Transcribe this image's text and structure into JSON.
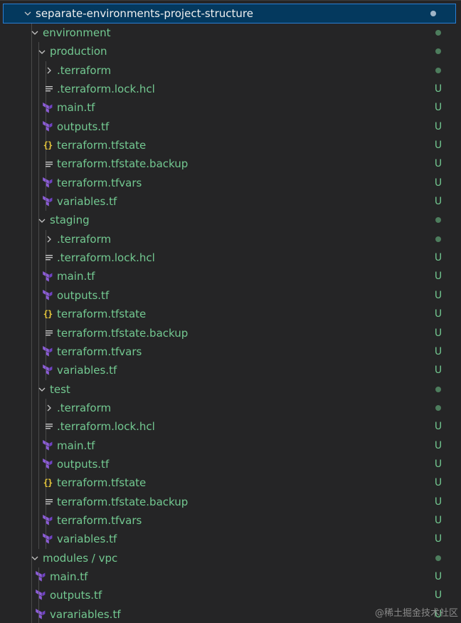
{
  "explorer": {
    "rows": [
      {
        "name": "separate-environments-project-structure",
        "kind": "folder-open",
        "depth": 0,
        "status": "dot",
        "root": true
      },
      {
        "name": "environment",
        "kind": "folder-open",
        "depth": 1,
        "status": "dot"
      },
      {
        "name": "production",
        "kind": "folder-open",
        "depth": 2,
        "status": "dot"
      },
      {
        "name": ".terraform",
        "kind": "folder-closed",
        "depth": 3,
        "status": "dot"
      },
      {
        "name": ".terraform.lock.hcl",
        "kind": "text-file",
        "depth": 3,
        "status": "U"
      },
      {
        "name": "main.tf",
        "kind": "terraform-file",
        "depth": 3,
        "status": "U"
      },
      {
        "name": "outputs.tf",
        "kind": "terraform-file",
        "depth": 3,
        "status": "U"
      },
      {
        "name": "terraform.tfstate",
        "kind": "json-file",
        "depth": 3,
        "status": "U"
      },
      {
        "name": "terraform.tfstate.backup",
        "kind": "text-file",
        "depth": 3,
        "status": "U"
      },
      {
        "name": "terraform.tfvars",
        "kind": "terraform-file",
        "depth": 3,
        "status": "U"
      },
      {
        "name": "variables.tf",
        "kind": "terraform-file",
        "depth": 3,
        "status": "U"
      },
      {
        "name": "staging",
        "kind": "folder-open",
        "depth": 2,
        "status": "dot"
      },
      {
        "name": ".terraform",
        "kind": "folder-closed",
        "depth": 3,
        "status": "dot"
      },
      {
        "name": ".terraform.lock.hcl",
        "kind": "text-file",
        "depth": 3,
        "status": "U"
      },
      {
        "name": "main.tf",
        "kind": "terraform-file",
        "depth": 3,
        "status": "U"
      },
      {
        "name": "outputs.tf",
        "kind": "terraform-file",
        "depth": 3,
        "status": "U"
      },
      {
        "name": "terraform.tfstate",
        "kind": "json-file",
        "depth": 3,
        "status": "U"
      },
      {
        "name": "terraform.tfstate.backup",
        "kind": "text-file",
        "depth": 3,
        "status": "U"
      },
      {
        "name": "terraform.tfvars",
        "kind": "terraform-file",
        "depth": 3,
        "status": "U"
      },
      {
        "name": "variables.tf",
        "kind": "terraform-file",
        "depth": 3,
        "status": "U"
      },
      {
        "name": "test",
        "kind": "folder-open",
        "depth": 2,
        "status": "dot"
      },
      {
        "name": ".terraform",
        "kind": "folder-closed",
        "depth": 3,
        "status": "dot"
      },
      {
        "name": ".terraform.lock.hcl",
        "kind": "text-file",
        "depth": 3,
        "status": "U"
      },
      {
        "name": "main.tf",
        "kind": "terraform-file",
        "depth": 3,
        "status": "U"
      },
      {
        "name": "outputs.tf",
        "kind": "terraform-file",
        "depth": 3,
        "status": "U"
      },
      {
        "name": "terraform.tfstate",
        "kind": "json-file",
        "depth": 3,
        "status": "U"
      },
      {
        "name": "terraform.tfstate.backup",
        "kind": "text-file",
        "depth": 3,
        "status": "U"
      },
      {
        "name": "terraform.tfvars",
        "kind": "terraform-file",
        "depth": 3,
        "status": "U"
      },
      {
        "name": "variables.tf",
        "kind": "terraform-file",
        "depth": 3,
        "status": "U"
      },
      {
        "name": "modules / vpc",
        "kind": "folder-open",
        "depth": 1,
        "status": "dot"
      },
      {
        "name": "main.tf",
        "kind": "terraform-file",
        "depth": 2,
        "status": "U"
      },
      {
        "name": "outputs.tf",
        "kind": "terraform-file",
        "depth": 2,
        "status": "U"
      },
      {
        "name": "varariables.tf",
        "kind": "terraform-file",
        "depth": 2,
        "status": "U"
      }
    ],
    "colors": {
      "background": "#252526",
      "untracked_text": "#73c991",
      "selection_background": "#04395e",
      "selection_border": "#2a7fd4",
      "terraform_icon": "#8b5cd6",
      "json_icon": "#e8c93b"
    }
  },
  "watermark": "@稀土掘金技术社区"
}
